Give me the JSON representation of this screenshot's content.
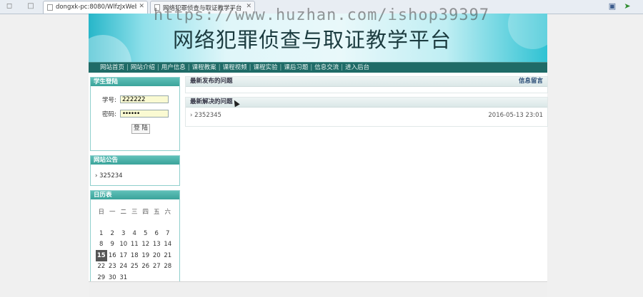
{
  "browser": {
    "tabs": [
      {
        "title": "dongxk-pc:8080/WlfzJxWeb"
      },
      {
        "title": "网络犯罪侦查与取证教学平台"
      }
    ]
  },
  "site": {
    "title": "网络犯罪侦查与取证教学平台",
    "watermark": "https://www.huzhan.com/ishop39397",
    "menu": [
      "网站首页",
      "网站介绍",
      "用户信息",
      "课程教案",
      "课程视频",
      "课程实验",
      "课后习题",
      "信息交流",
      "进入后台"
    ]
  },
  "login": {
    "title": "学生登陆",
    "username_label": "学号:",
    "username_value": "222222",
    "password_label": "密码:",
    "password_value": "••••••",
    "submit_label": "登 陆"
  },
  "notice": {
    "title": "网站公告",
    "items": [
      "325234"
    ]
  },
  "calendar": {
    "title": "日历表",
    "weekdays": [
      "日",
      "一",
      "二",
      "三",
      "四",
      "五",
      "六"
    ],
    "today": "15",
    "weeks": [
      [
        "",
        "",
        "",
        "",
        "",
        "",
        ""
      ],
      [
        "1",
        "2",
        "3",
        "4",
        "5",
        "6",
        "7"
      ],
      [
        "8",
        "9",
        "10",
        "11",
        "12",
        "13",
        "14"
      ],
      [
        "15",
        "16",
        "17",
        "18",
        "19",
        "20",
        "21"
      ],
      [
        "22",
        "23",
        "24",
        "25",
        "26",
        "27",
        "28"
      ],
      [
        "29",
        "30",
        "31",
        "",
        "",
        "",
        ""
      ]
    ]
  },
  "main": {
    "latest_questions_title": "最新发布的问题",
    "guestbook_link": "信息留言",
    "solved_title": "最新解决的问题",
    "solved_items": [
      {
        "text": "2352345",
        "date": "2016-05-13 23:01"
      }
    ]
  }
}
